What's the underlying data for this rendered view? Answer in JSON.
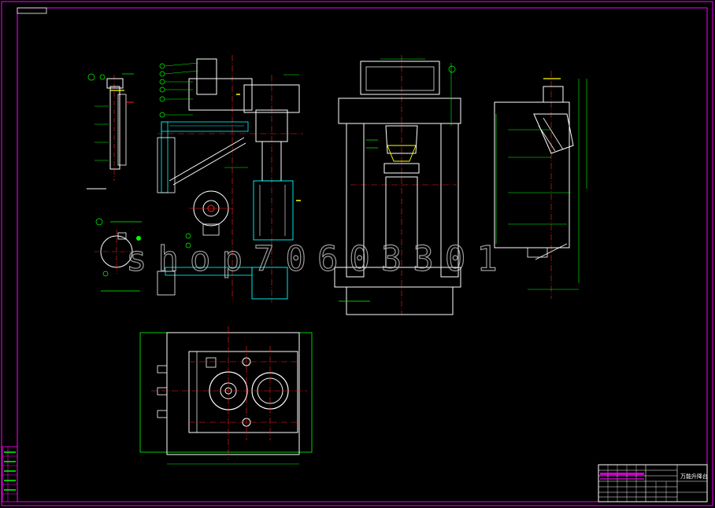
{
  "drawing": {
    "watermark_text": "shop70603301",
    "title_block_name": "万能升降台",
    "colors": {
      "background": "#000000",
      "border_frame": "#ff00ff",
      "geometry": "#ffffff",
      "centerlines": "#ff2020",
      "dimensions": "#00ff00",
      "section_hatch": "#00ffff",
      "highlight": "#ffff00"
    }
  }
}
